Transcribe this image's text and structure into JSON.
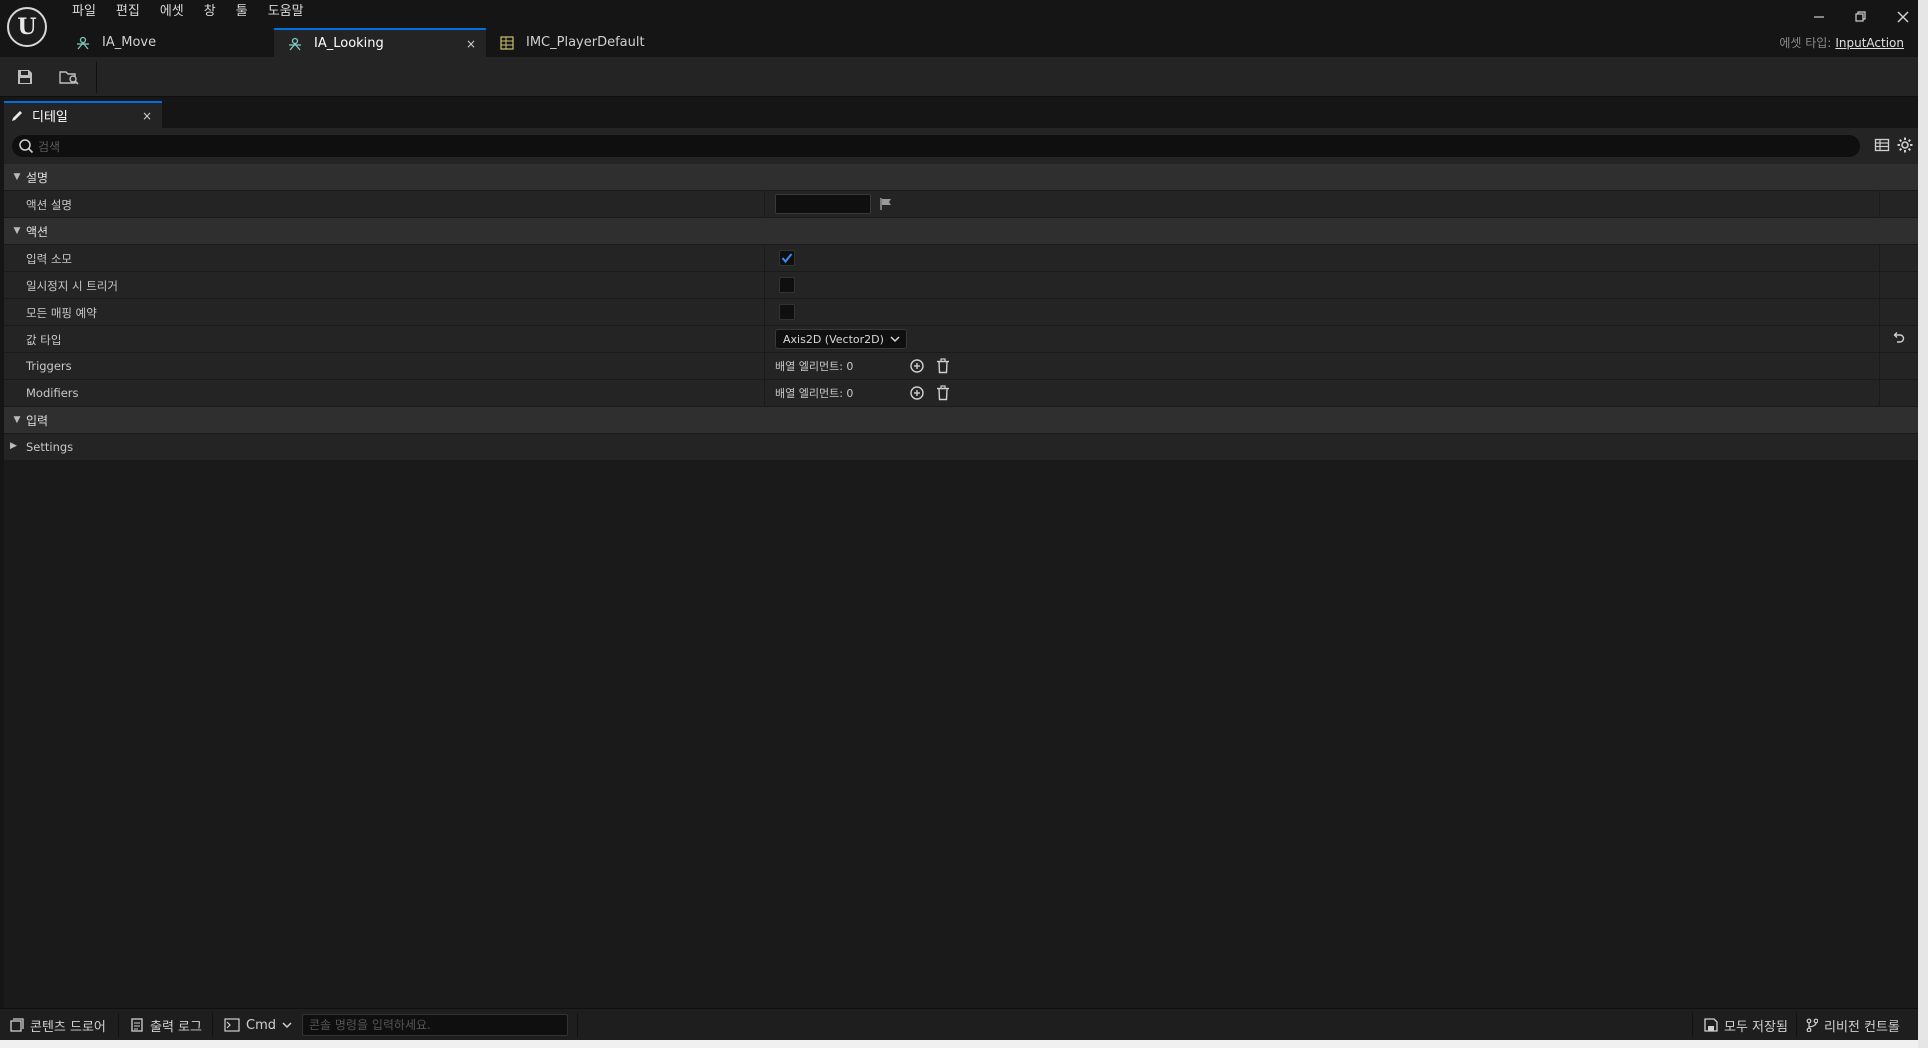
{
  "menu": [
    "파일",
    "편집",
    "에셋",
    "창",
    "툴",
    "도움말"
  ],
  "tabs": [
    {
      "label": "IA_Move",
      "icon": "input-action-icon"
    },
    {
      "label": "IA_Looking",
      "icon": "input-action-icon",
      "close": "×"
    },
    {
      "label": "IMC_PlayerDefault",
      "icon": "mapping-context-icon"
    }
  ],
  "asset_type": {
    "label": "에셋 타입:",
    "value": "InputAction"
  },
  "toolbar": {
    "save": "save-icon",
    "browse": "browse-icon"
  },
  "panel": {
    "title": "디테일",
    "close": "×"
  },
  "search": {
    "placeholder": "검색"
  },
  "sections": [
    {
      "label": "설명"
    },
    {
      "label": "액션"
    },
    {
      "label": "입력"
    }
  ],
  "rows": {
    "action_desc": {
      "label": "액션 설명",
      "value": ""
    },
    "consume_input": {
      "label": "입력 소모",
      "checked": true
    },
    "trigger_paused": {
      "label": "일시정지 시 트리거",
      "checked": false
    },
    "reserve_mappings": {
      "label": "모든 매핑 예약",
      "checked": false
    },
    "value_type": {
      "label": "값 타입",
      "value": "Axis2D (Vector2D)"
    },
    "triggers": {
      "label": "Triggers",
      "value": "배열 엘리먼트: 0"
    },
    "modifiers": {
      "label": "Modifiers",
      "value": "배열 엘리먼트: 0"
    },
    "settings": {
      "label": "Settings"
    }
  },
  "statusbar": {
    "content_drawer": "콘텐츠 드로어",
    "output_log": "출력 로그",
    "cmd": "Cmd",
    "console_placeholder": "콘솔 명령을 입력하세요.",
    "save_all": "모두 저장됨",
    "revision": "리비전 컨트롤"
  },
  "colors": {
    "accent": "#0070e0",
    "checkmark": "#3b8cf0",
    "bg": "#151515",
    "panel": "#242424"
  }
}
